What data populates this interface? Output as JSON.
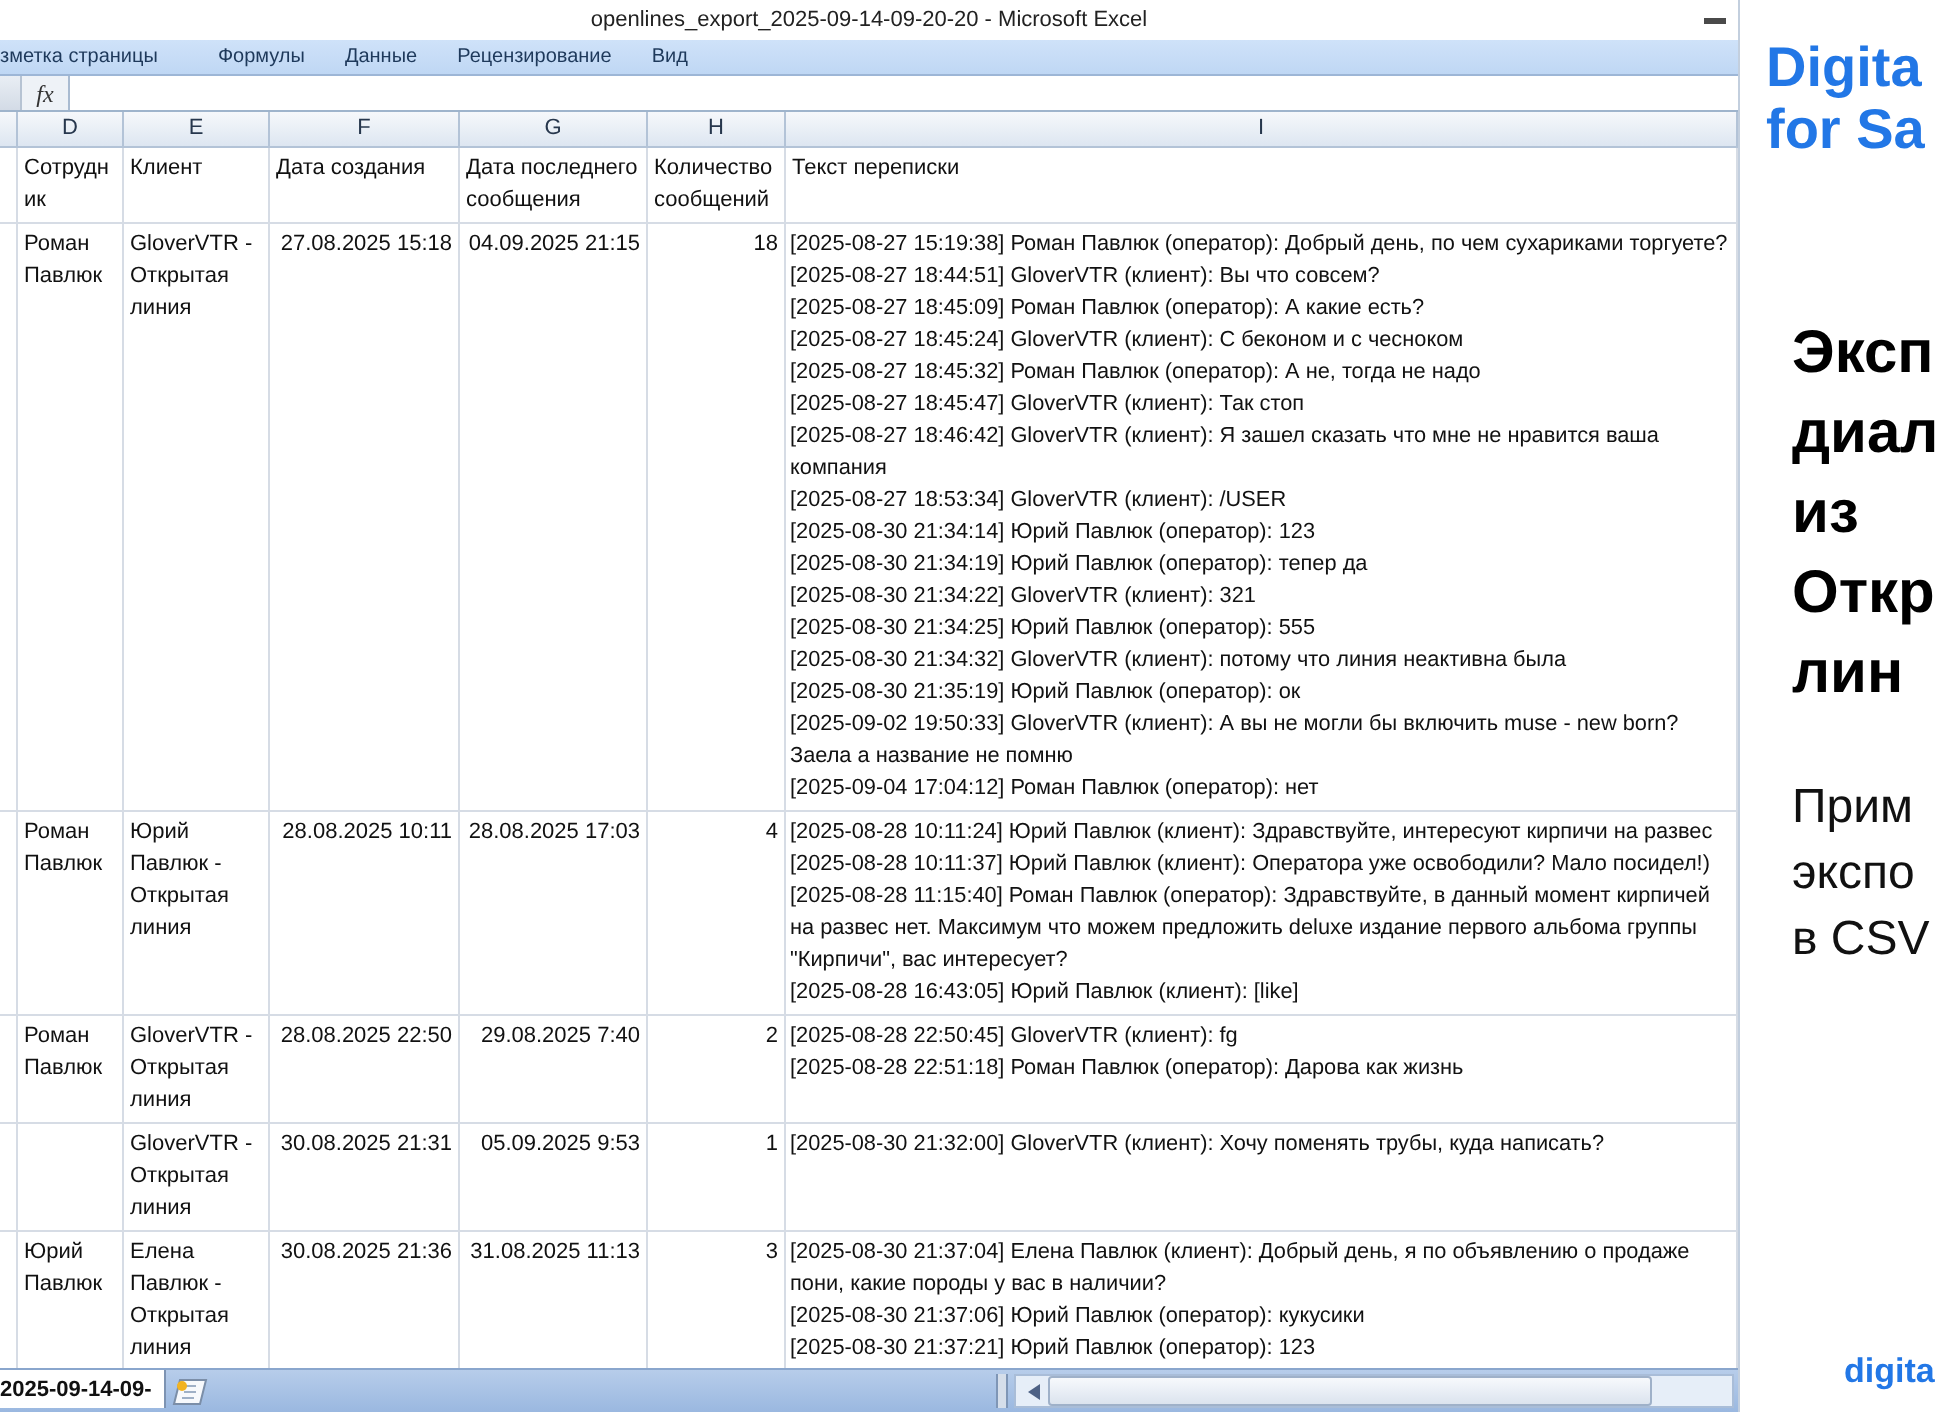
{
  "window": {
    "title": "openlines_export_2025-09-14-09-20-20 - Microsoft Excel"
  },
  "ribbon_tabs": [
    {
      "label": "зметка страницы",
      "selected": false
    },
    {
      "label": "Формулы",
      "selected": false
    },
    {
      "label": "Данные",
      "selected": false
    },
    {
      "label": "Рецензирование",
      "selected": false
    },
    {
      "label": "Вид",
      "selected": false
    }
  ],
  "formula_bar": {
    "function_label": "fx"
  },
  "sheet": {
    "columns": [
      {
        "letter": "D",
        "header": "Сотрудник"
      },
      {
        "letter": "E",
        "header": "Клиент"
      },
      {
        "letter": "F",
        "header": "Дата создания"
      },
      {
        "letter": "G",
        "header": "Дата последнего сообщения"
      },
      {
        "letter": "H",
        "header": "Количество сообщений"
      },
      {
        "letter": "I",
        "header": "Текст переписки"
      }
    ],
    "rows": [
      {
        "employee": "Роман Павлюк",
        "client": "GloverVTR - Открытая линия",
        "created": "27.08.2025 15:18",
        "last_message": "04.09.2025 21:15",
        "message_count": "18",
        "messages": [
          "[2025-08-27 15:19:38] Роман Павлюк (оператор): Добрый день, по чем сухариками торгуете?",
          "[2025-08-27 18:44:51] GloverVTR (клиент): Вы что совсем?",
          "[2025-08-27 18:45:09] Роман Павлюк (оператор): А какие есть?",
          "[2025-08-27 18:45:24] GloverVTR (клиент): С беконом и с чесноком",
          "[2025-08-27 18:45:32] Роман Павлюк (оператор): А не, тогда не надо",
          "[2025-08-27 18:45:47] GloverVTR (клиент): Так стоп",
          "[2025-08-27 18:46:42] GloverVTR (клиент): Я зашел сказать что мне не нравится ваша компания",
          "[2025-08-27 18:53:34] GloverVTR (клиент): /USER",
          "[2025-08-30 21:34:14] Юрий Павлюк (оператор): 123",
          "[2025-08-30 21:34:19] Юрий Павлюк (оператор): тепер да",
          "[2025-08-30 21:34:22] GloverVTR (клиент): 321",
          "[2025-08-30 21:34:25] Юрий Павлюк (оператор): 555",
          "[2025-08-30 21:34:32] GloverVTR (клиент): потому что линия неактивна была",
          "[2025-08-30 21:35:19] Юрий Павлюк (оператор): ок",
          "[2025-09-02 19:50:33] GloverVTR (клиент): А вы не могли бы включить muse - new born? Заела а название не помню",
          "[2025-09-04 17:04:12] Роман Павлюк (оператор): нет"
        ]
      },
      {
        "employee": "Роман Павлюк",
        "client": "Юрий Павлюк - Открытая линия",
        "created": "28.08.2025 10:11",
        "last_message": "28.08.2025 17:03",
        "message_count": "4",
        "messages": [
          "[2025-08-28 10:11:24] Юрий Павлюк (клиент): Здравствуйте, интересуют кирпичи на развес",
          "[2025-08-28 10:11:37] Юрий Павлюк (клиент): Оператора уже освободили? Мало посидел!)",
          "[2025-08-28 11:15:40] Роман Павлюк (оператор): Здравствуйте, в данный момент кирпичей на развес нет. Максимум что можем предложить deluxe издание первого альбома группы \"Кирпичи\", вас интересует?",
          "[2025-08-28 16:43:05] Юрий Павлюк (клиент): [like]"
        ]
      },
      {
        "employee": "Роман Павлюк",
        "client": "GloverVTR - Открытая линия",
        "created": "28.08.2025 22:50",
        "last_message": "29.08.2025 7:40",
        "message_count": "2",
        "messages": [
          "[2025-08-28 22:50:45] GloverVTR (клиент): fg",
          "[2025-08-28 22:51:18] Роман Павлюк (оператор): Дарова как жизнь"
        ]
      },
      {
        "client": "GloverVTR - Открытая линия",
        "created": "30.08.2025 21:31",
        "last_message": "05.09.2025 9:53",
        "message_count": "1",
        "messages": [
          "[2025-08-30 21:32:00] GloverVTR (клиент): Хочу поменять трубы, куда написать?"
        ]
      },
      {
        "employee": "Юрий Павлюк",
        "client": "Елена Павлюк - Открытая линия",
        "created": "30.08.2025 21:36",
        "last_message": "31.08.2025 11:13",
        "message_count": "3",
        "messages": [
          "[2025-08-30 21:37:04] Елена Павлюк (клиент): Добрый день, я по объявлению о продаже пони, какие породы у вас в наличии?",
          "[2025-08-30 21:37:06] Юрий Павлюк (оператор): кукусики",
          "[2025-08-30 21:37:21] Юрий Павлюк (оператор): 123"
        ]
      }
    ]
  },
  "sheet_tabs": [
    {
      "label": "2025-09-14-09-",
      "selected": true
    }
  ],
  "side_panel": {
    "brand_lines": [
      "Digita",
      "for Sa"
    ],
    "heading_lines": [
      "Эксп",
      "диал",
      "из",
      "Откр",
      "лин"
    ],
    "subtitle_lines": [
      "Прим",
      "экспо",
      "в CSV"
    ],
    "footer": "digita"
  }
}
